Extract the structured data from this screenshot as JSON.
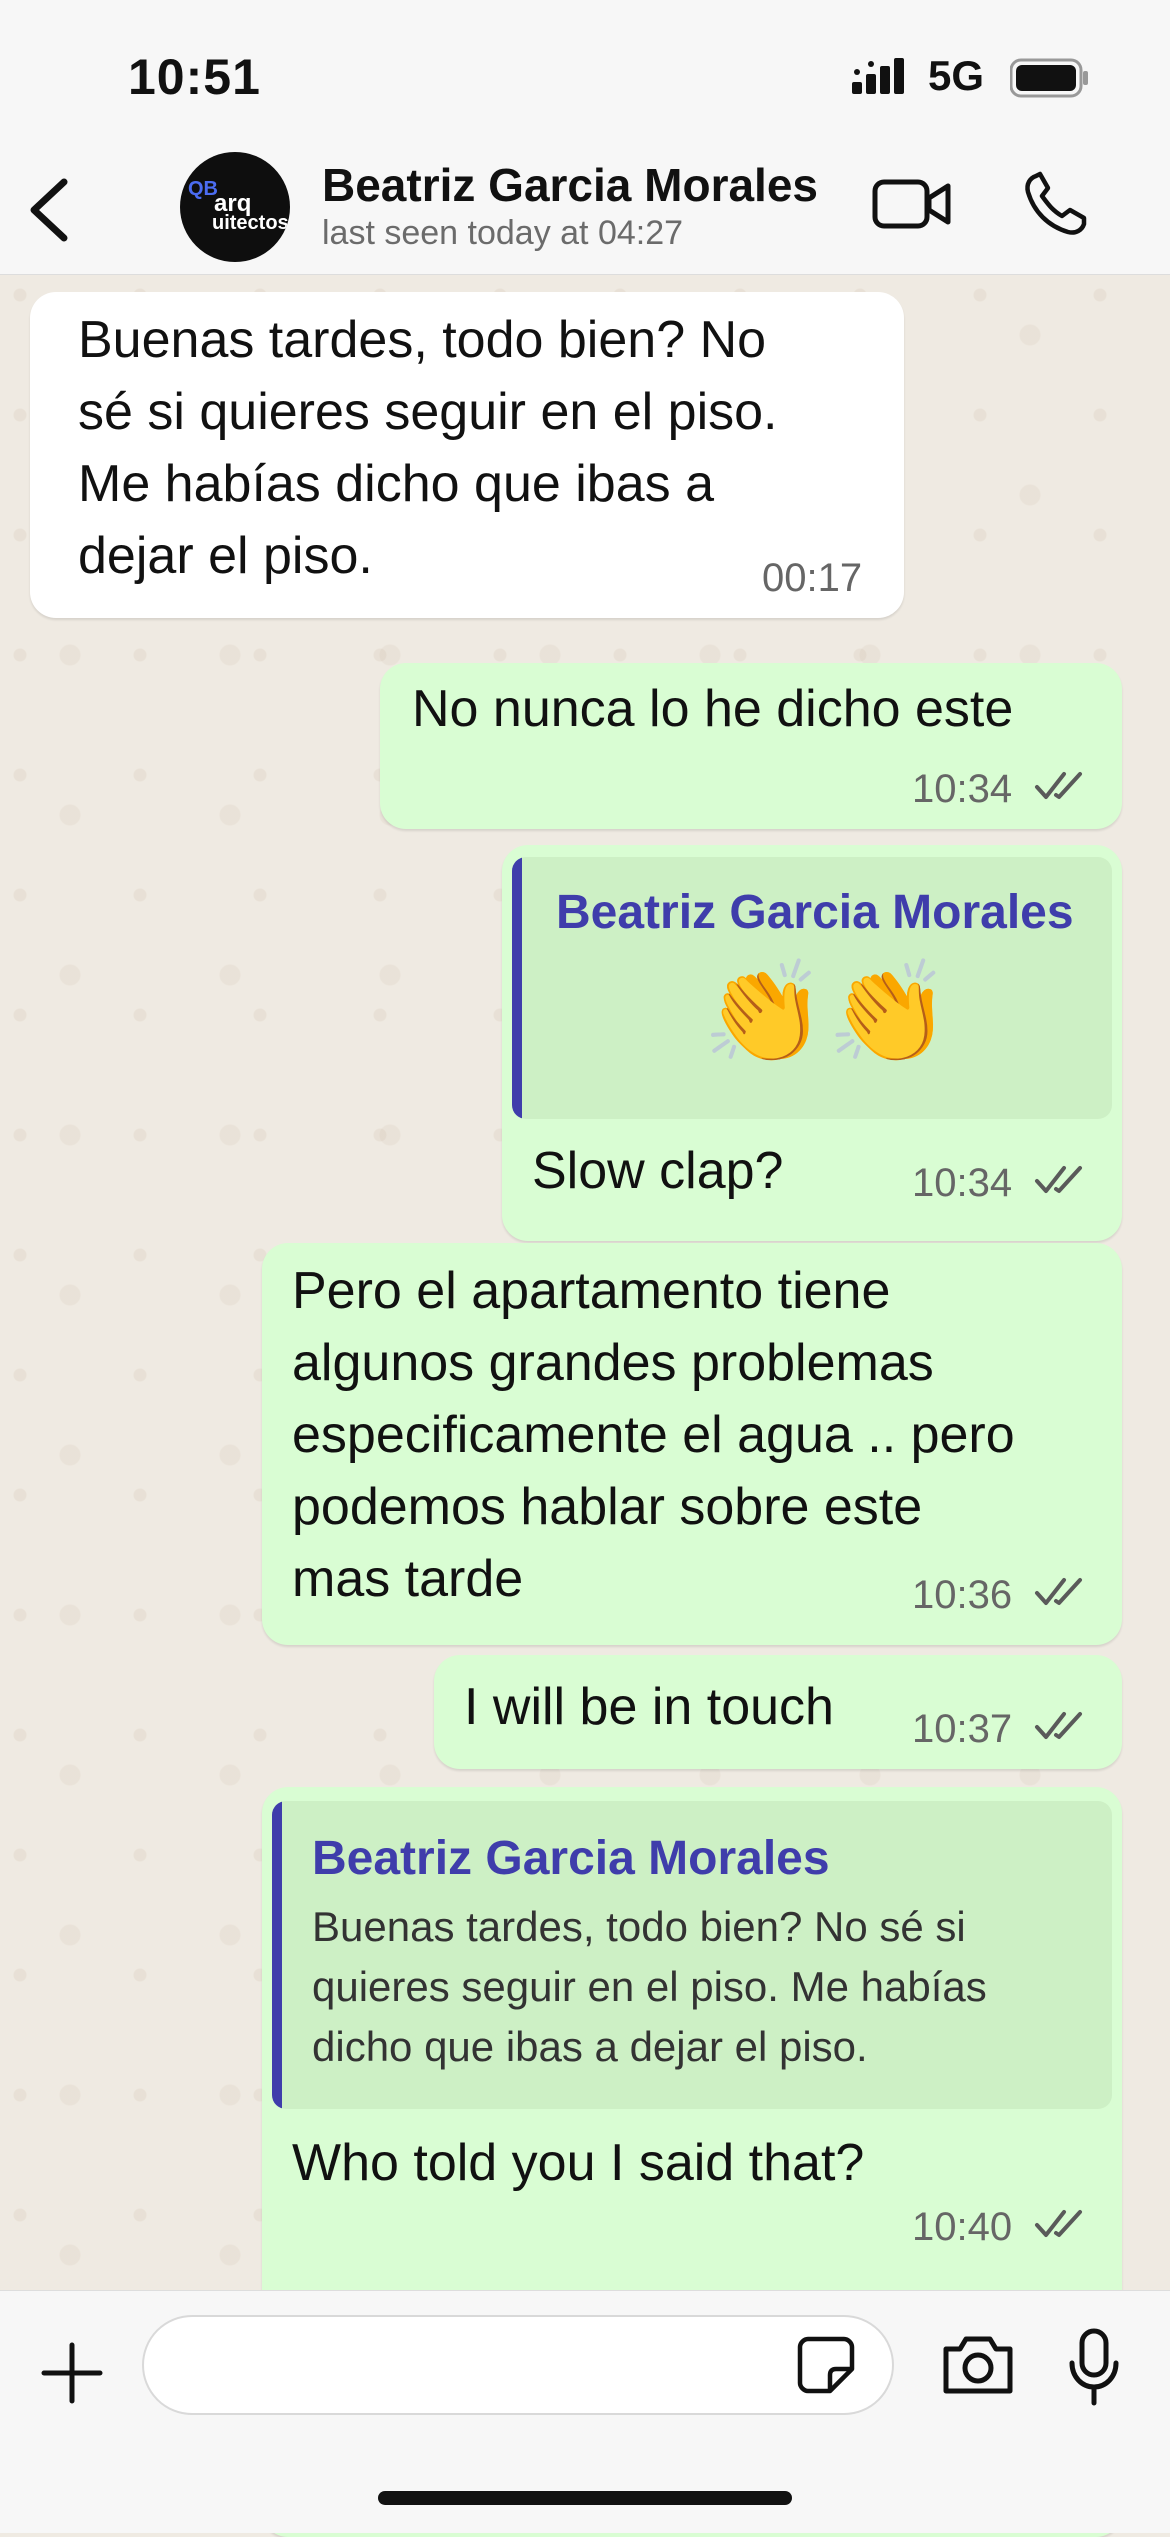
{
  "status_bar": {
    "time": "10:51",
    "network": "5G"
  },
  "header": {
    "contact_name": "Beatriz Garcia Morales",
    "last_seen": "last seen today at 04:27",
    "avatar": {
      "mark": "QB",
      "line1": "arq",
      "line2": "uitectos"
    },
    "icons": {
      "back": "chevron-left-icon",
      "video": "video-camera-icon",
      "call": "phone-icon"
    }
  },
  "messages": [
    {
      "direction": "incoming",
      "lines": [
        "Buenas tardes, todo bien? No",
        "sé si quieres seguir en el piso.",
        "Me habías dicho que ibas a",
        "dejar el piso."
      ],
      "time": "00:17"
    },
    {
      "direction": "outgoing",
      "lines": [
        "No nunca lo he dicho este"
      ],
      "time": "10:34",
      "read": true
    },
    {
      "direction": "outgoing",
      "quote": {
        "author": "Beatriz Garcia Morales",
        "text": "👏👏"
      },
      "lines": [
        "Slow clap?"
      ],
      "time": "10:34",
      "read": true
    },
    {
      "direction": "outgoing",
      "lines": [
        "Pero el apartamento tiene",
        "algunos grandes problemas",
        "especificamente el agua .. pero",
        "podemos hablar sobre este",
        "mas tarde"
      ],
      "time": "10:36",
      "read": true
    },
    {
      "direction": "outgoing",
      "lines": [
        "I will be in touch"
      ],
      "time": "10:37",
      "read": true
    },
    {
      "direction": "outgoing",
      "quote": {
        "author": "Beatriz Garcia Morales",
        "lines": [
          "Buenas tardes, todo bien? No sé si",
          "quieres seguir en el piso. Me habías",
          "dicho que ibas a dejar el piso."
        ]
      },
      "lines": [
        "Who told you I said that?"
      ],
      "time": "10:40",
      "read": true
    }
  ],
  "input": {
    "placeholder": "",
    "icons": [
      "plus-icon",
      "sticker-icon",
      "camera-icon",
      "microphone-icon"
    ]
  },
  "colors": {
    "outgoing_bubble": "#d9fdd3",
    "incoming_bubble": "#ffffff",
    "quote_accent": "#3f3dab",
    "read_ticks": "#5a5a5a"
  }
}
